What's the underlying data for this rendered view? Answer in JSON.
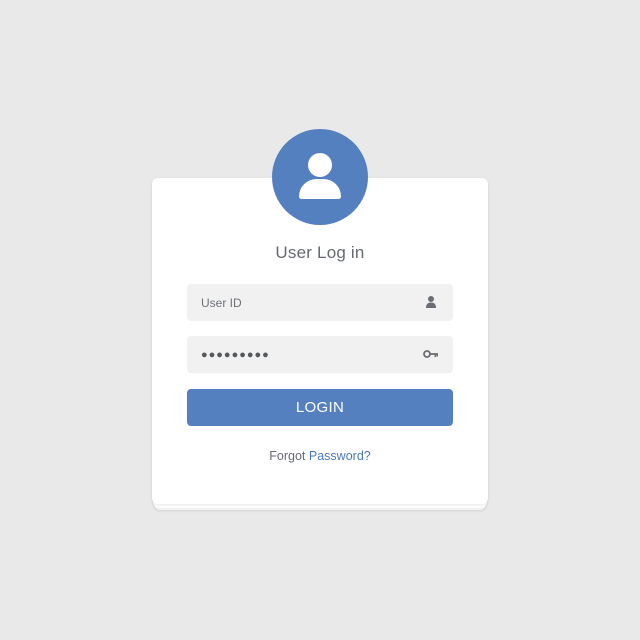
{
  "login": {
    "title": "User Log in",
    "user_id": {
      "placeholder": "User ID",
      "value": "",
      "icon": "user-icon"
    },
    "password": {
      "value": "●●●●●●●●●",
      "icon": "key-icon"
    },
    "login_button": "LOGIN",
    "forgot_prefix": "Forgot",
    "forgot_link": "Password?",
    "avatar_icon": "user-avatar-icon"
  },
  "colors": {
    "background": "#e9e9e9",
    "card": "#ffffff",
    "accent": "#5580bf",
    "field": "#f1f1f1",
    "text": "#666a70",
    "link": "#4d78b8"
  }
}
